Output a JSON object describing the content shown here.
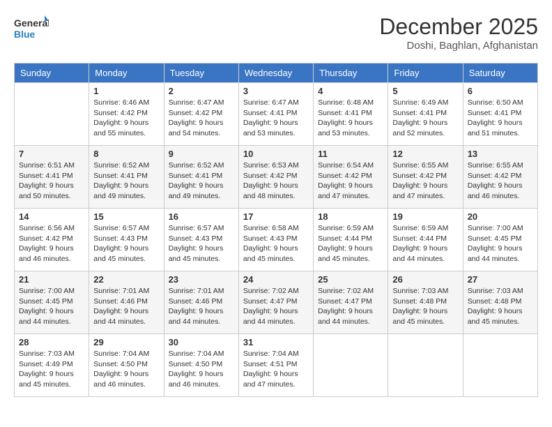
{
  "logo": {
    "general": "General",
    "blue": "Blue"
  },
  "header": {
    "month_year": "December 2025",
    "location": "Doshi, Baghlan, Afghanistan"
  },
  "weekdays": [
    "Sunday",
    "Monday",
    "Tuesday",
    "Wednesday",
    "Thursday",
    "Friday",
    "Saturday"
  ],
  "weeks": [
    [
      {
        "day": "",
        "info": ""
      },
      {
        "day": "1",
        "info": "Sunrise: 6:46 AM\nSunset: 4:42 PM\nDaylight: 9 hours\nand 55 minutes."
      },
      {
        "day": "2",
        "info": "Sunrise: 6:47 AM\nSunset: 4:42 PM\nDaylight: 9 hours\nand 54 minutes."
      },
      {
        "day": "3",
        "info": "Sunrise: 6:47 AM\nSunset: 4:41 PM\nDaylight: 9 hours\nand 53 minutes."
      },
      {
        "day": "4",
        "info": "Sunrise: 6:48 AM\nSunset: 4:41 PM\nDaylight: 9 hours\nand 53 minutes."
      },
      {
        "day": "5",
        "info": "Sunrise: 6:49 AM\nSunset: 4:41 PM\nDaylight: 9 hours\nand 52 minutes."
      },
      {
        "day": "6",
        "info": "Sunrise: 6:50 AM\nSunset: 4:41 PM\nDaylight: 9 hours\nand 51 minutes."
      }
    ],
    [
      {
        "day": "7",
        "info": "Sunrise: 6:51 AM\nSunset: 4:41 PM\nDaylight: 9 hours\nand 50 minutes."
      },
      {
        "day": "8",
        "info": "Sunrise: 6:52 AM\nSunset: 4:41 PM\nDaylight: 9 hours\nand 49 minutes."
      },
      {
        "day": "9",
        "info": "Sunrise: 6:52 AM\nSunset: 4:41 PM\nDaylight: 9 hours\nand 49 minutes."
      },
      {
        "day": "10",
        "info": "Sunrise: 6:53 AM\nSunset: 4:42 PM\nDaylight: 9 hours\nand 48 minutes."
      },
      {
        "day": "11",
        "info": "Sunrise: 6:54 AM\nSunset: 4:42 PM\nDaylight: 9 hours\nand 47 minutes."
      },
      {
        "day": "12",
        "info": "Sunrise: 6:55 AM\nSunset: 4:42 PM\nDaylight: 9 hours\nand 47 minutes."
      },
      {
        "day": "13",
        "info": "Sunrise: 6:55 AM\nSunset: 4:42 PM\nDaylight: 9 hours\nand 46 minutes."
      }
    ],
    [
      {
        "day": "14",
        "info": "Sunrise: 6:56 AM\nSunset: 4:42 PM\nDaylight: 9 hours\nand 46 minutes."
      },
      {
        "day": "15",
        "info": "Sunrise: 6:57 AM\nSunset: 4:43 PM\nDaylight: 9 hours\nand 45 minutes."
      },
      {
        "day": "16",
        "info": "Sunrise: 6:57 AM\nSunset: 4:43 PM\nDaylight: 9 hours\nand 45 minutes."
      },
      {
        "day": "17",
        "info": "Sunrise: 6:58 AM\nSunset: 4:43 PM\nDaylight: 9 hours\nand 45 minutes."
      },
      {
        "day": "18",
        "info": "Sunrise: 6:59 AM\nSunset: 4:44 PM\nDaylight: 9 hours\nand 45 minutes."
      },
      {
        "day": "19",
        "info": "Sunrise: 6:59 AM\nSunset: 4:44 PM\nDaylight: 9 hours\nand 44 minutes."
      },
      {
        "day": "20",
        "info": "Sunrise: 7:00 AM\nSunset: 4:45 PM\nDaylight: 9 hours\nand 44 minutes."
      }
    ],
    [
      {
        "day": "21",
        "info": "Sunrise: 7:00 AM\nSunset: 4:45 PM\nDaylight: 9 hours\nand 44 minutes."
      },
      {
        "day": "22",
        "info": "Sunrise: 7:01 AM\nSunset: 4:46 PM\nDaylight: 9 hours\nand 44 minutes."
      },
      {
        "day": "23",
        "info": "Sunrise: 7:01 AM\nSunset: 4:46 PM\nDaylight: 9 hours\nand 44 minutes."
      },
      {
        "day": "24",
        "info": "Sunrise: 7:02 AM\nSunset: 4:47 PM\nDaylight: 9 hours\nand 44 minutes."
      },
      {
        "day": "25",
        "info": "Sunrise: 7:02 AM\nSunset: 4:47 PM\nDaylight: 9 hours\nand 44 minutes."
      },
      {
        "day": "26",
        "info": "Sunrise: 7:03 AM\nSunset: 4:48 PM\nDaylight: 9 hours\nand 45 minutes."
      },
      {
        "day": "27",
        "info": "Sunrise: 7:03 AM\nSunset: 4:48 PM\nDaylight: 9 hours\nand 45 minutes."
      }
    ],
    [
      {
        "day": "28",
        "info": "Sunrise: 7:03 AM\nSunset: 4:49 PM\nDaylight: 9 hours\nand 45 minutes."
      },
      {
        "day": "29",
        "info": "Sunrise: 7:04 AM\nSunset: 4:50 PM\nDaylight: 9 hours\nand 46 minutes."
      },
      {
        "day": "30",
        "info": "Sunrise: 7:04 AM\nSunset: 4:50 PM\nDaylight: 9 hours\nand 46 minutes."
      },
      {
        "day": "31",
        "info": "Sunrise: 7:04 AM\nSunset: 4:51 PM\nDaylight: 9 hours\nand 47 minutes."
      },
      {
        "day": "",
        "info": ""
      },
      {
        "day": "",
        "info": ""
      },
      {
        "day": "",
        "info": ""
      }
    ]
  ]
}
